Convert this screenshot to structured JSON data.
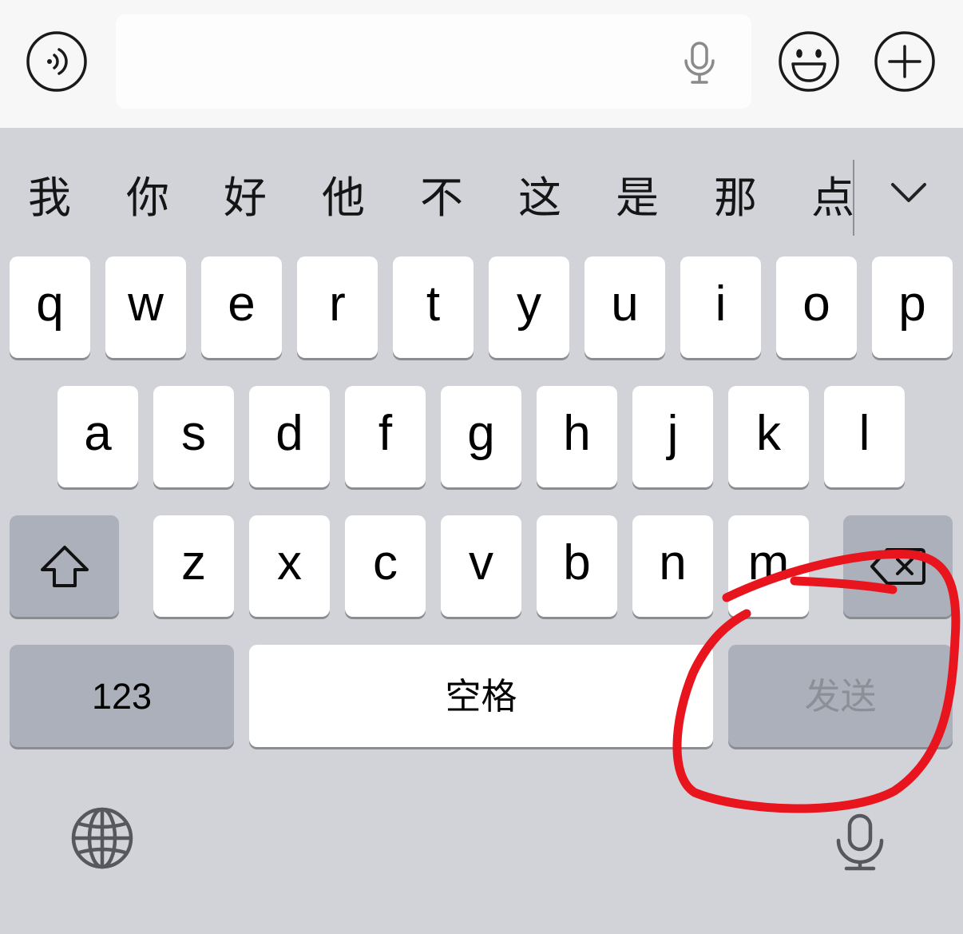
{
  "top_bar": {
    "voice_icon": "voice-input-icon",
    "mic_icon": "microphone-icon",
    "emoji_icon": "emoji-icon",
    "plus_icon": "plus-icon"
  },
  "candidates": [
    "我",
    "你",
    "好",
    "他",
    "不",
    "这",
    "是",
    "那",
    "点"
  ],
  "keyboard": {
    "row1": [
      "q",
      "w",
      "e",
      "r",
      "t",
      "y",
      "u",
      "i",
      "o",
      "p"
    ],
    "row2": [
      "a",
      "s",
      "d",
      "f",
      "g",
      "h",
      "j",
      "k",
      "l"
    ],
    "row3": [
      "z",
      "x",
      "c",
      "v",
      "b",
      "n",
      "m"
    ],
    "shift_icon": "shift-icon",
    "backspace_icon": "backspace-icon",
    "numbers_label": "123",
    "space_label": "空格",
    "send_label": "发送",
    "globe_icon": "globe-icon",
    "dictation_icon": "microphone-icon",
    "expand_icon": "chevron-down-icon"
  },
  "annotation": "red hand-drawn circle around send key",
  "colors": {
    "keyboard_bg": "#d1d3d9",
    "topbar_bg": "#f7f7f7",
    "key_bg": "#ffffff",
    "function_key_bg": "#abb0ba",
    "send_text": "#8b8f97",
    "annotation": "#e8141e"
  }
}
